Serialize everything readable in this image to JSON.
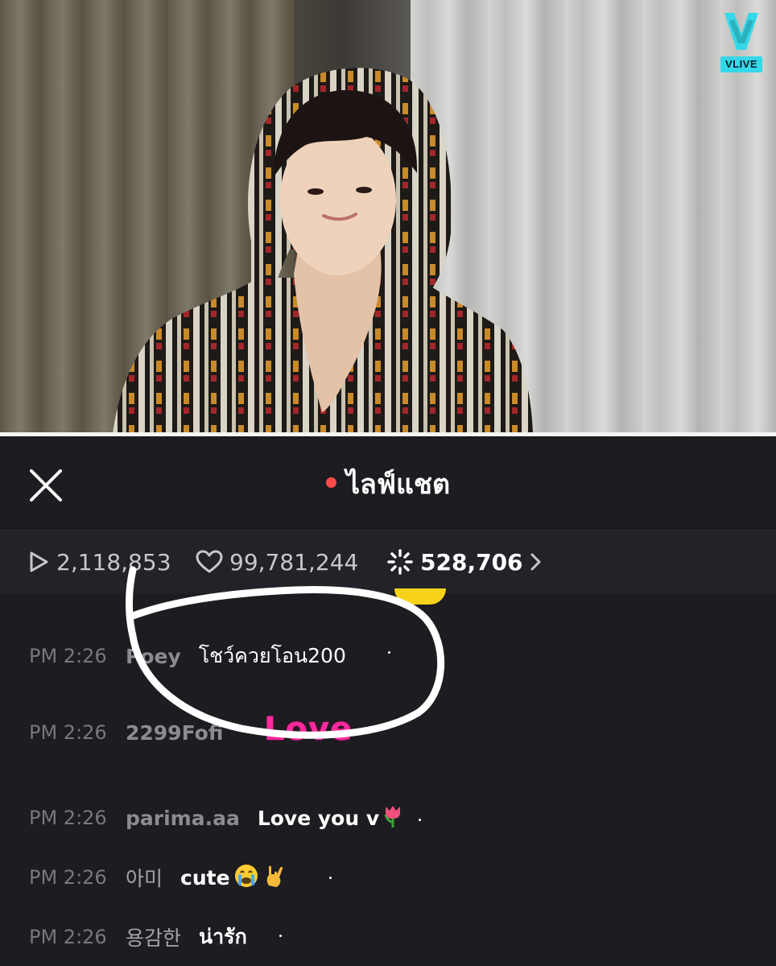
{
  "app": {
    "logo_text": "VLIVE"
  },
  "chat_header": {
    "title": "ไลฟ์แชต"
  },
  "stats": {
    "plays": "2,118,853",
    "likes": "99,781,244",
    "points": "528,706"
  },
  "messages": [
    {
      "time": "PM 2:26",
      "user": "Poey",
      "text": "โชว์ควยโอน200"
    },
    {
      "time": "PM 2:26",
      "user": "2299Fofi",
      "text": ""
    },
    {
      "time": "PM 2:26",
      "user": "parima.aa",
      "text": "Love you v"
    },
    {
      "time": "PM 2:26",
      "user": "아미",
      "text": "cute"
    },
    {
      "time": "PM 2:26",
      "user": "용감한",
      "text": "น่ารัก"
    }
  ],
  "stickers": {
    "love": "Love"
  },
  "colors": {
    "background": "#1c1c21",
    "live_dot": "#ff4b4b",
    "vlive_accent": "#35d8e8",
    "love_sticker": "#ff2b9c"
  },
  "icons": [
    "close-icon",
    "play-icon",
    "heart-icon",
    "sparkle-points-icon",
    "chevron-right-icon",
    "vlive-logo-icon",
    "tulip-emoji",
    "crying-emoji",
    "rock-hand-emoji"
  ]
}
